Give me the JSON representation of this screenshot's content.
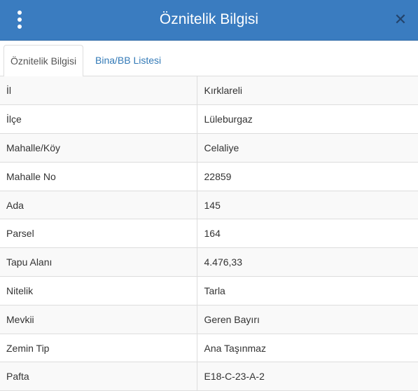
{
  "header": {
    "title": "Öznitelik Bilgisi",
    "menu_icon": "vertical-dots-icon",
    "close_icon": "close-icon",
    "background_color": "#3a7cc0"
  },
  "tabs": [
    {
      "label": "Öznitelik Bilgisi",
      "active": true
    },
    {
      "label": "Bina/BB Listesi",
      "active": false
    }
  ],
  "attributes": [
    {
      "key": "İl",
      "value": "Kırklareli"
    },
    {
      "key": "İlçe",
      "value": "Lüleburgaz"
    },
    {
      "key": "Mahalle/Köy",
      "value": "Celaliye"
    },
    {
      "key": "Mahalle No",
      "value": "22859"
    },
    {
      "key": "Ada",
      "value": "145"
    },
    {
      "key": "Parsel",
      "value": "164"
    },
    {
      "key": "Tapu Alanı",
      "value": "4.476,33"
    },
    {
      "key": "Nitelik",
      "value": "Tarla"
    },
    {
      "key": "Mevkii",
      "value": "Geren Bayırı"
    },
    {
      "key": "Zemin Tip",
      "value": "Ana Taşınmaz"
    },
    {
      "key": "Pafta",
      "value": "E18-C-23-A-2"
    }
  ]
}
